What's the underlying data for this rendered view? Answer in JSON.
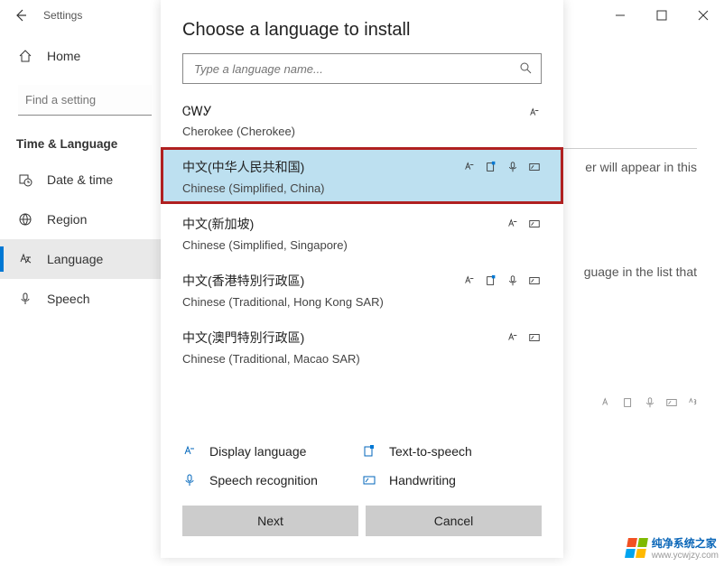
{
  "titlebar": {
    "app_title": "Settings"
  },
  "sidebar": {
    "home": "Home",
    "search_placeholder": "Find a setting",
    "section": "Time & Language",
    "items": [
      {
        "label": "Date & time"
      },
      {
        "label": "Region"
      },
      {
        "label": "Language"
      },
      {
        "label": "Speech"
      }
    ]
  },
  "background": {
    "line1_fragment": "er will appear in this",
    "line2_fragment": "guage in the list that"
  },
  "dialog": {
    "title": "Choose a language to install",
    "search_placeholder": "Type a language name...",
    "languages": [
      {
        "native": "ᏣᎳᎩ",
        "english": "Cherokee (Cherokee)",
        "selected": false,
        "features": [
          "display"
        ]
      },
      {
        "native": "中文(中华人民共和国)",
        "english": "Chinese (Simplified, China)",
        "selected": true,
        "features": [
          "display",
          "tts",
          "speech",
          "handwriting"
        ]
      },
      {
        "native": "中文(新加坡)",
        "english": "Chinese (Simplified, Singapore)",
        "selected": false,
        "features": [
          "display",
          "handwriting"
        ]
      },
      {
        "native": "中文(香港特別行政區)",
        "english": "Chinese (Traditional, Hong Kong SAR)",
        "selected": false,
        "features": [
          "display",
          "tts",
          "speech",
          "handwriting"
        ]
      },
      {
        "native": "中文(澳門特別行政區)",
        "english": "Chinese (Traditional, Macao SAR)",
        "selected": false,
        "features": [
          "display",
          "handwriting"
        ]
      }
    ],
    "legend": {
      "display": "Display language",
      "tts": "Text-to-speech",
      "speech": "Speech recognition",
      "handwriting": "Handwriting"
    },
    "buttons": {
      "next": "Next",
      "cancel": "Cancel"
    }
  },
  "watermark": {
    "line1": "纯净系统之家",
    "line2": "www.ycwjzy.com"
  }
}
